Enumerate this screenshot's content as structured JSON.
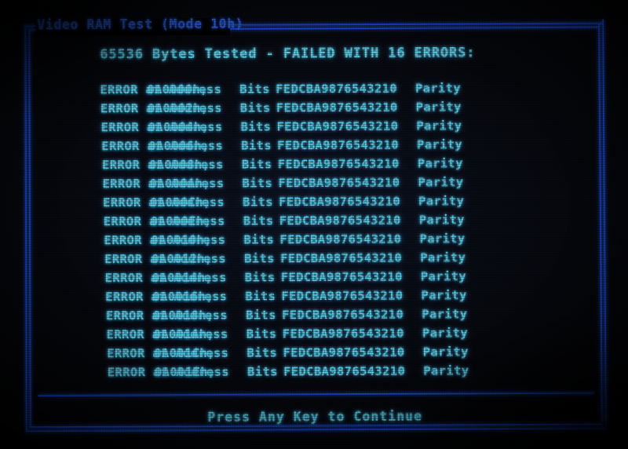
{
  "screen": {
    "window_title": "Video RAM Test (Mode 10h)",
    "result_heading": "65536 Bytes Tested - FAILED WITH 16 ERRORS:",
    "continue_prompt": "Press Any Key to Continue",
    "bytes_tested": "65536",
    "error_count": "16"
  },
  "colors": {
    "frame": "#1b49d6",
    "title_text": "#2f63e2",
    "body_text": "#5fd6f2",
    "heading_text": "#63dcf4",
    "background": "#000000"
  },
  "error_columns": {
    "label": "ERROR at Address",
    "bits_word": "Bits",
    "kind": "Parity"
  },
  "errors": [
    {
      "label": "ERROR at Address",
      "address": "0A0000h,",
      "bits_word": "Bits",
      "bits": "FEDCBA9876543210",
      "kind": "Parity"
    },
    {
      "label": "ERROR at Address",
      "address": "0A0002h,",
      "bits_word": "Bits",
      "bits": "FEDCBA9876543210",
      "kind": "Parity"
    },
    {
      "label": "ERROR at Address",
      "address": "0A0004h,",
      "bits_word": "Bits",
      "bits": "FEDCBA9876543210",
      "kind": "Parity"
    },
    {
      "label": "ERROR at Address",
      "address": "0A0006h,",
      "bits_word": "Bits",
      "bits": "FEDCBA9876543210",
      "kind": "Parity"
    },
    {
      "label": "ERROR at Address",
      "address": "0A0008h,",
      "bits_word": "Bits",
      "bits": "FEDCBA9876543210",
      "kind": "Parity"
    },
    {
      "label": "ERROR at Address",
      "address": "0A000Ah,",
      "bits_word": "Bits",
      "bits": "FEDCBA9876543210",
      "kind": "Parity"
    },
    {
      "label": "ERROR at Address",
      "address": "0A000Ch,",
      "bits_word": "Bits",
      "bits": "FEDCBA9876543210",
      "kind": "Parity"
    },
    {
      "label": "ERROR at Address",
      "address": "0A000Eh,",
      "bits_word": "Bits",
      "bits": "FEDCBA9876543210",
      "kind": "Parity"
    },
    {
      "label": "ERROR at Address",
      "address": "0A0010h,",
      "bits_word": "Bits",
      "bits": "FEDCBA9876543210",
      "kind": "Parity"
    },
    {
      "label": "ERROR at Address",
      "address": "0A0012h,",
      "bits_word": "Bits",
      "bits": "FEDCBA9876543210",
      "kind": "Parity"
    },
    {
      "label": "ERROR at Address",
      "address": "0A0014h,",
      "bits_word": "Bits",
      "bits": "FEDCBA9876543210",
      "kind": "Parity"
    },
    {
      "label": "ERROR at Address",
      "address": "0A0016h,",
      "bits_word": "Bits",
      "bits": "FEDCBA9876543210",
      "kind": "Parity"
    },
    {
      "label": "ERROR at Address",
      "address": "0A0018h,",
      "bits_word": "Bits",
      "bits": "FEDCBA9876543210",
      "kind": "Parity"
    },
    {
      "label": "ERROR at Address",
      "address": "0A001Ah,",
      "bits_word": "Bits",
      "bits": "FEDCBA9876543210",
      "kind": "Parity"
    },
    {
      "label": "ERROR at Address",
      "address": "0A001Ch,",
      "bits_word": "Bits",
      "bits": "FEDCBA9876543210",
      "kind": "Parity"
    },
    {
      "label": "ERROR at Address",
      "address": "0A001Eh,",
      "bits_word": "Bits",
      "bits": "FEDCBA9876543210",
      "kind": "Parity"
    }
  ]
}
